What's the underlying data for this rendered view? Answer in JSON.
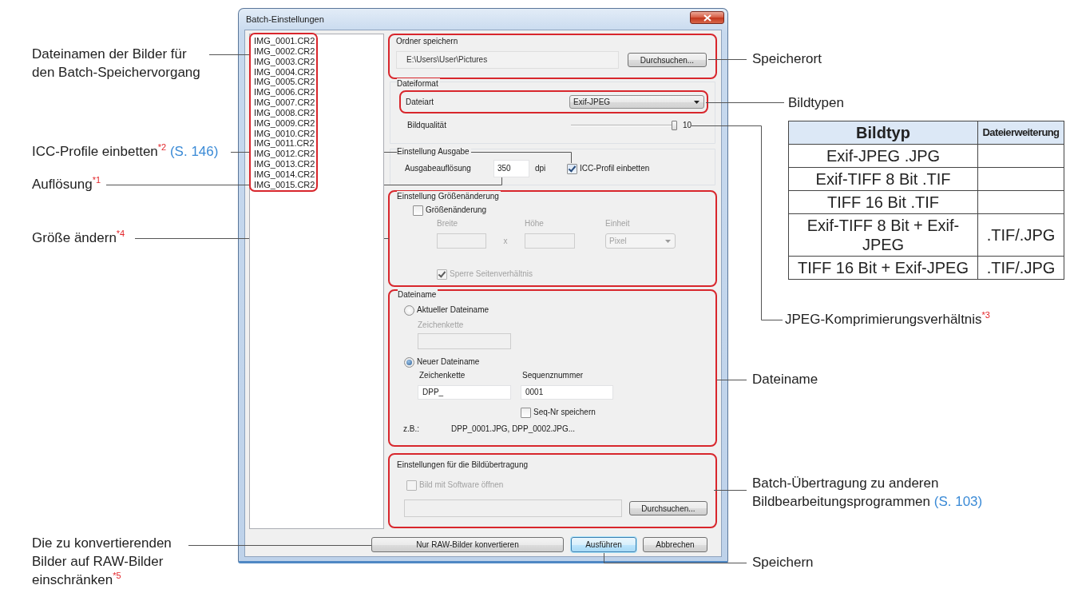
{
  "dialog": {
    "title": "Batch-Einstellungen",
    "file_list": {
      "highlighted": true,
      "items": [
        "IMG_0001.CR2",
        "IMG_0002.CR2",
        "IMG_0003.CR2",
        "IMG_0004.CR2",
        "IMG_0005.CR2",
        "IMG_0006.CR2",
        "IMG_0007.CR2",
        "IMG_0008.CR2",
        "IMG_0009.CR2",
        "IMG_0010.CR2",
        "IMG_0011.CR2",
        "IMG_0012.CR2",
        "IMG_0013.CR2",
        "IMG_0014.CR2",
        "IMG_0015.CR2"
      ]
    },
    "save_folder": {
      "highlighted": true,
      "label": "Ordner speichern",
      "path": "E:\\Users\\User\\Pictures",
      "browse_button": "Durchsuchen..."
    },
    "file_format": {
      "label": "Dateiformat",
      "type": {
        "highlighted": true,
        "label": "Dateiart",
        "value": "Exif-JPEG"
      },
      "quality": {
        "label": "Bildqualität",
        "level": 1,
        "reading": "10"
      }
    },
    "output": {
      "label": "Einstellung Ausgabe",
      "resolution_label": "Ausgabeauflösung",
      "resolution": "350",
      "unit": "dpi",
      "embed_icc": {
        "label": "ICC-Profil einbetten",
        "checked": true
      }
    },
    "resize": {
      "highlighted": true,
      "label": "Einstellung Größenänderung",
      "enable": {
        "label": "Größenänderung",
        "checked": false
      },
      "width_label": "Breite",
      "height_label": "Höhe",
      "separator": "x",
      "unit_label": "Einheit",
      "unit_value": "Pixel",
      "lock_ratio": {
        "label": "Sperre Seitenverhältnis",
        "checked": true
      }
    },
    "file_name": {
      "highlighted": true,
      "label": "Dateiname",
      "current": {
        "label": "Aktueller Dateiname",
        "selected": false,
        "string_label": "Zeichenkette"
      },
      "new": {
        "label": "Neuer Dateiname",
        "selected": true,
        "string_label": "Zeichenkette",
        "string_value": "DPP_",
        "sequence_label": "Sequenznummer",
        "sequence_value": "0001"
      },
      "keep_sequence": {
        "label": "Seq-Nr speichern",
        "checked": false
      },
      "example_label": "z.B.:",
      "example": "DPP_0001.JPG, DPP_0002.JPG..."
    },
    "transfer": {
      "highlighted": true,
      "label": "Einstellungen für die Bildübertragung",
      "open_with": {
        "label": "Bild mit Software öffnen",
        "checked": false,
        "disabled": true
      },
      "browse_button": "Durchsuchen..."
    },
    "buttons": [
      {
        "label": "Nur RAW-Bilder konvertieren",
        "default": false
      },
      {
        "label": "Ausführen",
        "default": true
      },
      {
        "label": "Abbrechen",
        "default": false
      }
    ]
  },
  "left_callouts": [
    {
      "text": "Dateinamen der Bilder für\nden Batch-Speichervorgang"
    },
    {
      "text": "ICC-Profile einbetten$^{*2}$",
      "link": "(S. 146)"
    },
    {
      "text": "Auflösung$^{*1}$"
    },
    {
      "text": "Größe ändern$^{*4}$"
    },
    {
      "text": "Die zu konvertierenden\nBilder auf RAW-Bilder\neinschränken$^{*5}$"
    }
  ],
  "right_callouts": [
    {
      "text": "Speicherort"
    },
    {
      "text": "Bildtypen"
    },
    {
      "text": "JPEG-Komprimierungsverhältnis$^{*3}$"
    },
    {
      "text": "Dateiname"
    },
    {
      "text": "Batch-Übertragung zu anderen\nBildbearbeitungsprogrammen",
      "link": "(S. 103)"
    },
    {
      "text": "Speichern"
    }
  ],
  "table": {
    "columns": [
      "Bildtyp",
      "Dateierweiterung"
    ],
    "rows": [
      [
        "Exif-JPEG .JPG"
      ],
      [
        "Exif-TIFF 8 Bit .TIF"
      ],
      [
        "TIFF 16 Bit .TIF"
      ],
      [
        "Exif-TIFF 8 Bit + Exif-JPEG",
        ".TIF/.JPG"
      ],
      [
        "TIFF 16 Bit + Exif-JPEG",
        ".TIF/.JPG"
      ]
    ]
  }
}
